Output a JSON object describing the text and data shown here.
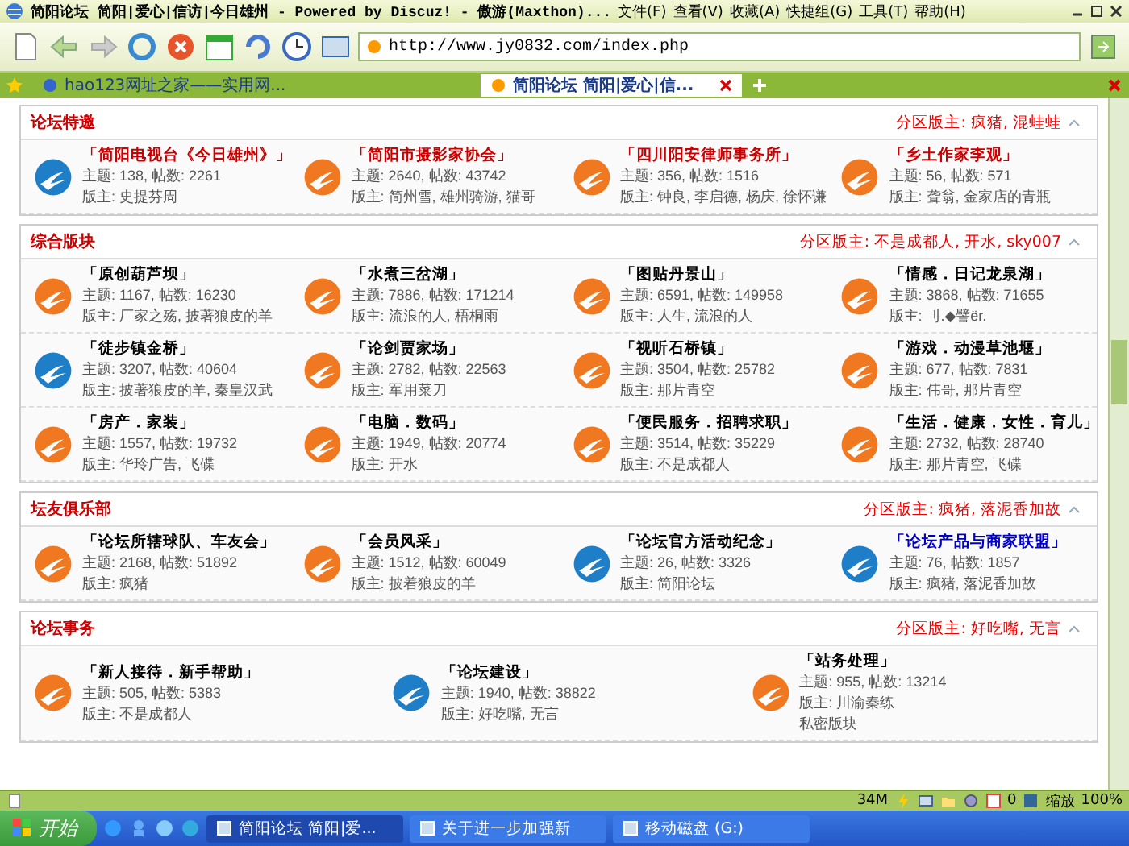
{
  "window": {
    "title": "简阳论坛 简阳|爱心|信访|今日雄州 - Powered by Discuz! - 傲游(Maxthon)...",
    "menu": [
      "文件(F)",
      "查看(V)",
      "收藏(A)",
      "快捷组(G)",
      "工具(T)",
      "帮助(H)"
    ]
  },
  "address": "http://www.jy0832.com/index.php",
  "tabs": [
    {
      "label": "hao123网址之家——实用网...",
      "selected": false
    },
    {
      "label": "简阳论坛 简阳|爱心|信...",
      "selected": true
    }
  ],
  "sections": [
    {
      "title": "论坛特邀",
      "moderators_label": "分区版主:",
      "moderators": "疯猪, 混蛙蛙",
      "forums": [
        {
          "name": "「简阳电视台《今日雄州》」",
          "color": "#cc0000",
          "has_new": false,
          "stats": "主题: 138, 帖数: 2261",
          "moderators": "版主: 史提芬周"
        },
        {
          "name": "「简阳市摄影家协会」",
          "color": "#cc0000",
          "has_new": true,
          "stats": "主题: 2640, 帖数: 43742",
          "moderators": "版主: 简州雪, 雄州骑游, 猫哥"
        },
        {
          "name": "「四川阳安律师事务所」",
          "color": "#cc0000",
          "has_new": true,
          "stats": "主题: 356, 帖数: 1516",
          "moderators": "版主: 钟良, 李启德, 杨庆, 徐怀谦"
        },
        {
          "name": "「乡土作家李观」",
          "color": "#cc0000",
          "has_new": true,
          "stats": "主题: 56, 帖数: 571",
          "moderators": "版主: 聋翁, 金家店的青瓶"
        }
      ]
    },
    {
      "title": "综合版块",
      "moderators_label": "分区版主:",
      "moderators": "不是成都人, 开水, sky007",
      "forums": [
        {
          "name": "「原创葫芦坝」",
          "color": "#000000",
          "has_new": true,
          "stats": "主题: 1167, 帖数: 16230",
          "moderators": "版主: 厂家之殇, 披著狼皮的羊"
        },
        {
          "name": "「水煮三岔湖」",
          "color": "#000000",
          "has_new": true,
          "stats": "主题: 7886, 帖数: 171214",
          "moderators": "版主: 流浪的人, 梧桐雨"
        },
        {
          "name": "「图贴丹景山」",
          "color": "#000000",
          "has_new": true,
          "stats": "主题: 6591, 帖数: 149958",
          "moderators": "版主: 人生, 流浪的人"
        },
        {
          "name": "「情感．日记龙泉湖」",
          "color": "#000000",
          "has_new": true,
          "stats": "主题: 3868, 帖数: 71655",
          "moderators": "版主: 刂.◆譬ёr."
        },
        {
          "name": "「徒步镇金桥」",
          "color": "#000000",
          "has_new": false,
          "stats": "主题: 3207, 帖数: 40604",
          "moderators": "版主: 披著狼皮的羊, 秦皇汉武"
        },
        {
          "name": "「论剑贾家场」",
          "color": "#000000",
          "has_new": true,
          "stats": "主题: 2782, 帖数: 22563",
          "moderators": "版主: 军用菜刀"
        },
        {
          "name": "「视听石桥镇」",
          "color": "#000000",
          "has_new": true,
          "stats": "主题: 3504, 帖数: 25782",
          "moderators": "版主: 那片青空"
        },
        {
          "name": "「游戏．动漫草池堰」",
          "color": "#000000",
          "has_new": true,
          "stats": "主题: 677, 帖数: 7831",
          "moderators": "版主: 伟哥, 那片青空"
        },
        {
          "name": "「房产．家装」",
          "color": "#000000",
          "has_new": true,
          "stats": "主题: 1557, 帖数: 19732",
          "moderators": "版主: 华玲广告, 飞碟"
        },
        {
          "name": "「电脑．数码」",
          "color": "#000000",
          "has_new": true,
          "stats": "主题: 1949, 帖数: 20774",
          "moderators": "版主: 开水"
        },
        {
          "name": "「便民服务．招聘求职」",
          "color": "#000000",
          "has_new": true,
          "stats": "主题: 3514, 帖数: 35229",
          "moderators": "版主: 不是成都人"
        },
        {
          "name": "「生活．健康．女性．育儿」",
          "color": "#000000",
          "has_new": true,
          "stats": "主题: 2732, 帖数: 28740",
          "moderators": "版主: 那片青空, 飞碟"
        }
      ]
    },
    {
      "title": "坛友俱乐部",
      "moderators_label": "分区版主:",
      "moderators": "疯猪, 落泥香加故",
      "forums": [
        {
          "name": "「论坛所辖球队、车友会」",
          "color": "#000000",
          "has_new": true,
          "stats": "主题: 2168, 帖数: 51892",
          "moderators": "版主: 疯猪"
        },
        {
          "name": "「会员风采」",
          "color": "#000000",
          "has_new": true,
          "stats": "主题: 1512, 帖数: 60049",
          "moderators": "版主: 披着狼皮的羊"
        },
        {
          "name": "「论坛官方活动纪念」",
          "color": "#000000",
          "has_new": false,
          "stats": "主题: 26, 帖数: 3326",
          "moderators": "版主: 简阳论坛"
        },
        {
          "name": "「论坛产品与商家联盟」",
          "color": "#0000cc",
          "has_new": false,
          "stats": "主题: 76, 帖数: 1857",
          "moderators": "版主: 疯猪, 落泥香加故"
        }
      ]
    },
    {
      "title": "论坛事务",
      "moderators_label": "分区版主:",
      "moderators": "好吃嘴, 无言",
      "forums": [
        {
          "name": "「新人接待．新手帮助」",
          "color": "#000000",
          "has_new": true,
          "stats": "主题: 505, 帖数: 5383",
          "moderators": "版主: 不是成都人"
        },
        {
          "name": "「论坛建设」",
          "color": "#000000",
          "has_new": false,
          "stats": "主题: 1940, 帖数: 38822",
          "moderators": "版主: 好吃嘴, 无言"
        },
        {
          "name": "「站务处理」",
          "color": "#000000",
          "has_new": true,
          "stats": "主题: 955, 帖数: 13214",
          "moderators": "版主: 川渝秦练",
          "note": "私密版块"
        }
      ]
    }
  ],
  "status_bar": {
    "memory": "34M",
    "counter": "0",
    "zoom_label": "缩放",
    "zoom": "100%"
  },
  "taskbar": {
    "start": "开始",
    "tasks": [
      {
        "label": "简阳论坛 简阳|爱...",
        "selected": true
      },
      {
        "label": "关于进一步加强新",
        "selected": false
      },
      {
        "label": "移动磁盘 (G:)",
        "selected": false
      }
    ]
  }
}
